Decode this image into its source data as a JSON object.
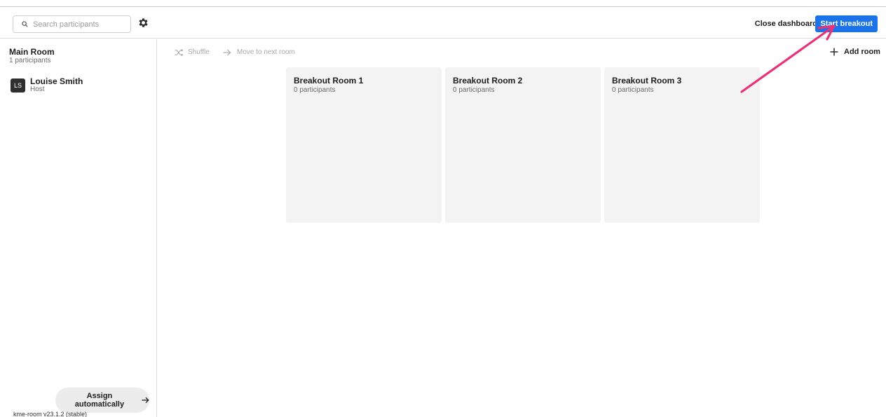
{
  "header": {
    "search_placeholder": "Search participants",
    "close_dashboard_label": "Close dashboard",
    "start_breakout_label": "Start breakout",
    "accent_color": "#1a73e8"
  },
  "sidebar": {
    "main_room": {
      "title": "Main Room",
      "count": "1 participants",
      "participants": [
        {
          "initials": "LS",
          "name": "Louise Smith",
          "role": "Host"
        }
      ]
    },
    "assign_label": "Assign automatically",
    "version": "kme-room v23.1.2 (stable)"
  },
  "toolbar": {
    "shuffle_label": "Shuffle",
    "move_next_label": "Move to next room",
    "add_room_label": "Add room"
  },
  "rooms": [
    {
      "title": "Breakout Room 1",
      "count": "0 participants"
    },
    {
      "title": "Breakout Room 2",
      "count": "0 participants"
    },
    {
      "title": "Breakout Room 3",
      "count": "0 participants"
    }
  ],
  "annotation": {
    "arrow_color": "#e8337a"
  },
  "icons": {
    "search": "search-icon",
    "settings": "gear-icon",
    "shuffle": "shuffle-icon",
    "move": "arrow-right-icon",
    "add": "plus-icon",
    "assign": "arrow-right-icon"
  }
}
